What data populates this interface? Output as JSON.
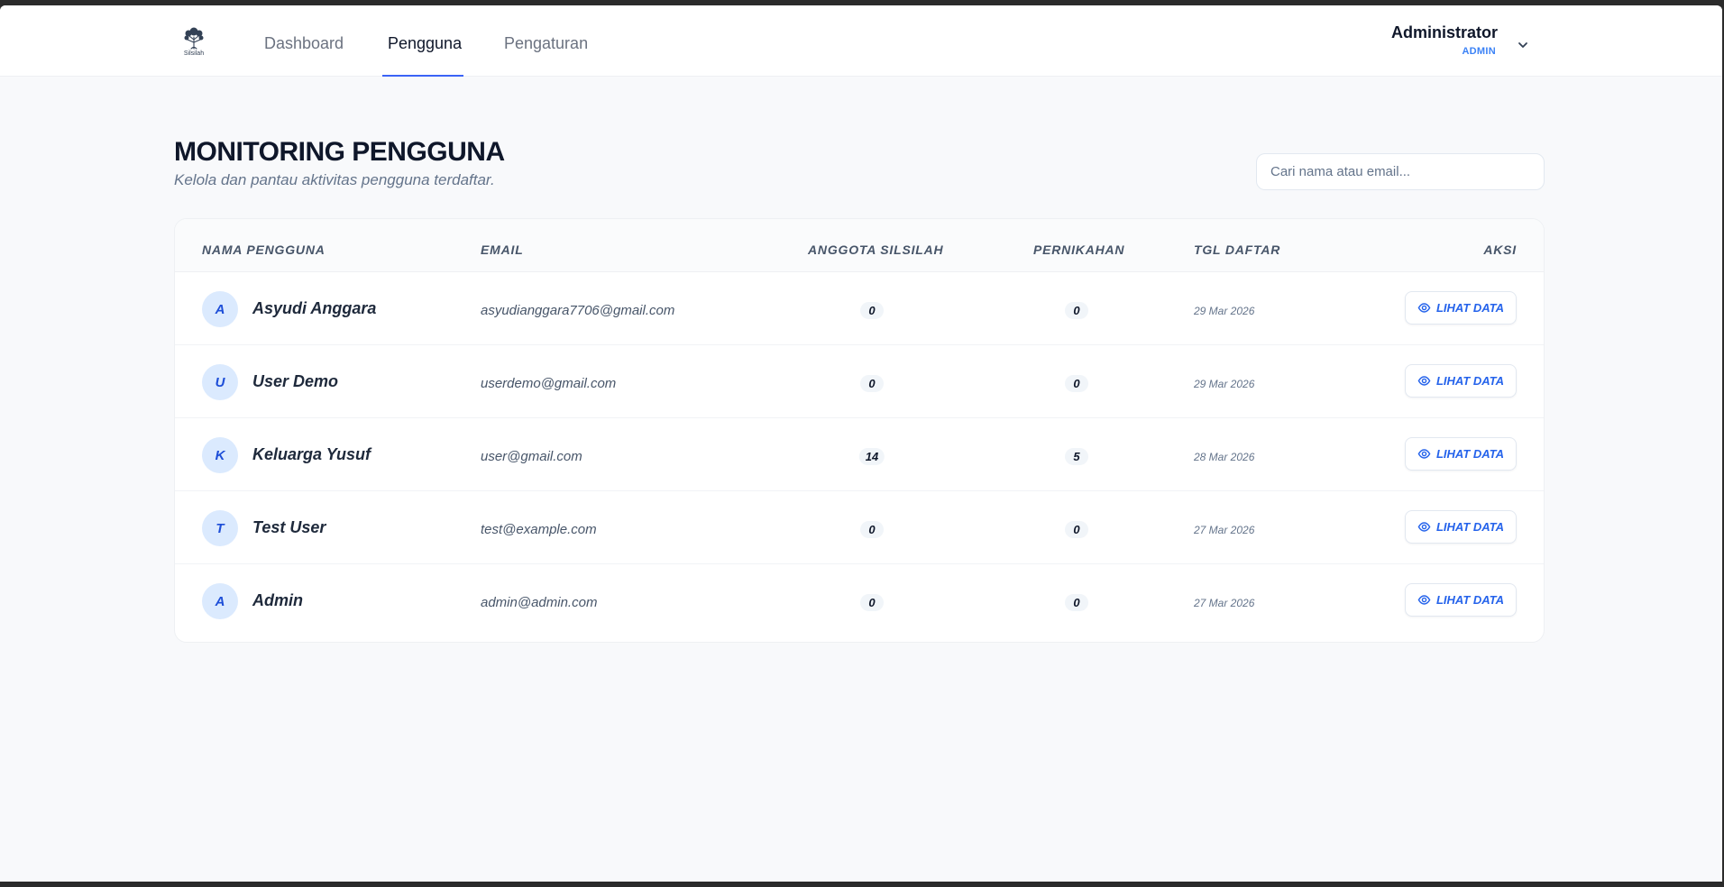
{
  "app": {
    "logo_text": "Silsilah"
  },
  "nav": {
    "items": [
      {
        "label": "Dashboard",
        "active": false
      },
      {
        "label": "Pengguna",
        "active": true
      },
      {
        "label": "Pengaturan",
        "active": false
      }
    ]
  },
  "user": {
    "name": "Administrator",
    "role": "ADMIN"
  },
  "page": {
    "title": "MONITORING PENGGUNA",
    "subtitle": "Kelola dan pantau aktivitas pengguna terdaftar."
  },
  "search": {
    "placeholder": "Cari nama atau email...",
    "value": ""
  },
  "table": {
    "headers": {
      "name": "NAMA PENGGUNA",
      "email": "EMAIL",
      "members": "ANGGOTA SILSILAH",
      "marriages": "PERNIKAHAN",
      "date": "TGL DAFTAR",
      "action": "AKSI"
    },
    "action_label": "LIHAT DATA",
    "rows": [
      {
        "initial": "A",
        "name": "Asyudi Anggara",
        "email": "asyudianggara7706@gmail.com",
        "members": "0",
        "marriages": "0",
        "date": "29 Mar 2026"
      },
      {
        "initial": "U",
        "name": "User Demo",
        "email": "userdemo@gmail.com",
        "members": "0",
        "marriages": "0",
        "date": "29 Mar 2026"
      },
      {
        "initial": "K",
        "name": "Keluarga Yusuf",
        "email": "user@gmail.com",
        "members": "14",
        "marriages": "5",
        "date": "28 Mar 2026"
      },
      {
        "initial": "T",
        "name": "Test User",
        "email": "test@example.com",
        "members": "0",
        "marriages": "0",
        "date": "27 Mar 2026"
      },
      {
        "initial": "A",
        "name": "Admin",
        "email": "admin@admin.com",
        "members": "0",
        "marriages": "0",
        "date": "27 Mar 2026"
      }
    ]
  },
  "colors": {
    "accent": "#2563eb",
    "nav_underline": "#3b63f6",
    "avatar_bg": "#dbeafe",
    "page_bg": "#f8f9fb"
  },
  "icons": {
    "logo": "tree-icon",
    "user_menu": "chevron-down-icon",
    "action": "eye-icon"
  }
}
